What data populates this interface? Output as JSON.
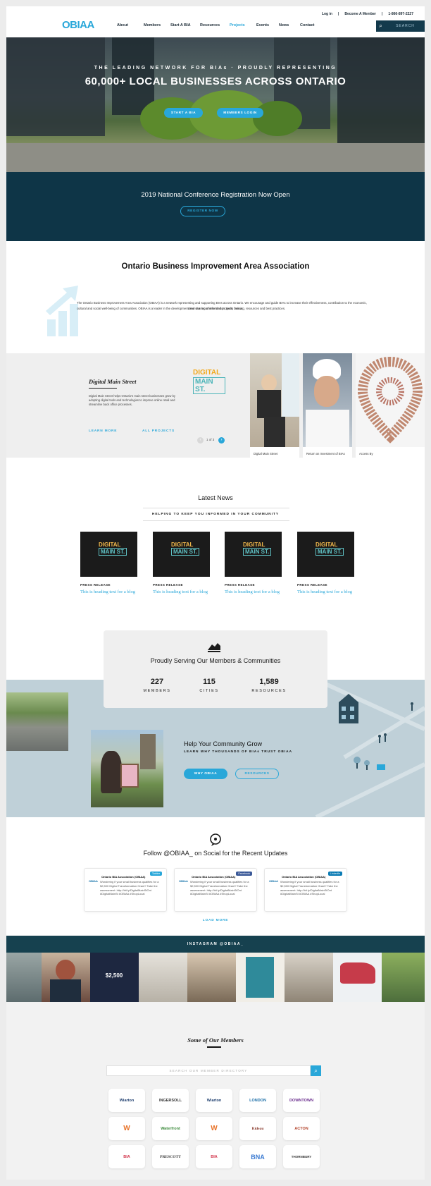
{
  "header": {
    "util_links": [
      "Log in",
      "|",
      "Become A Member",
      "|",
      "1-866-897-2227"
    ],
    "logo_text": "OBIAA",
    "nav": [
      "About",
      "Members",
      "Start A BIA",
      "Resources",
      "Projects",
      "Events",
      "News",
      "Contact"
    ],
    "active_nav": "Projects",
    "search_placeholder": "SEARCH"
  },
  "hero": {
    "eyebrow": "THE LEADING NETWORK FOR BIAs · PROUDLY REPRESENTING",
    "headline": "60,000+ LOCAL BUSINESSES ACROSS ONTARIO",
    "btn_primary": "START A BIA",
    "btn_secondary": "MEMBERS LOGIN"
  },
  "conference": {
    "title": "2019 National Conference Registration Now Open",
    "button": "REGISTER NOW"
  },
  "about": {
    "title": "Ontario Business Improvement Area Association",
    "body": "The Ontario Business Improvement Area Association (OBIAA) is a network representing and supporting BIAs across Ontario. We encourage and guide BIAs to increase their effectiveness, contribution to the economic, cultural and social well-being of communities. OBIAA is a leader in the development and sharing of information, tools, training, resources and best practices.",
    "projects_intro": "View our recommended projects below:"
  },
  "projects": {
    "title": "Digital Main Street",
    "description": "Digital Main Street helps Ontario's main street businesses grow by adopting digital tools and technologies to improve online retail and streamline back office processes.",
    "learn_more": "LEARN MORE",
    "all_projects": "ALL PROJECTS",
    "pager": "1 of 3",
    "logo_line1": "DIGITAL",
    "logo_line2": "MAIN ST.",
    "tiles": [
      "Digital Main Street",
      "Return on Investment of BIAs",
      "Access By"
    ]
  },
  "news": {
    "title": "Latest News",
    "subtitle": "HELPING TO KEEP YOU INFORMED IN YOUR COMMUNITY",
    "cards": [
      {
        "label": "PRESS RELEASE",
        "title": "This is heading text for a blog"
      },
      {
        "label": "PRESS RELEASE",
        "title": "This is heading text for a blog"
      },
      {
        "label": "PRESS RELEASE",
        "title": "This is heading text for a blog"
      },
      {
        "label": "PRESS RELEASE",
        "title": "This is heading text for a blog"
      }
    ],
    "sign_line1": "DIGITAL",
    "sign_line2": "MAIN ST."
  },
  "stats": {
    "title": "Proudly Serving Our Members & Communities",
    "items": [
      {
        "value": "227",
        "label": "MEMBERS"
      },
      {
        "value": "115",
        "label": "CITIES"
      },
      {
        "value": "1,589",
        "label": "RESOURCES"
      }
    ]
  },
  "grow": {
    "title": "Help Your Community Grow",
    "subtitle": "LEARN WHY THOUSANDS OF BIAs TRUST OBIAA",
    "btn_primary": "WHY OBIAA",
    "btn_secondary": "RESOURCES"
  },
  "social": {
    "title": "Follow @OBIAA_ on Social for the Recent Updates",
    "cards": [
      {
        "account": "Ontario BIA Association (OBIAA)",
        "network": "Twitter",
        "body": "Wondering if your small business qualifies for a $2,500 Digital Transformation Grant? Take the assessment: http://bit.ly/DigitalMainStOnt #DigitalMainSt #OBIAA #ShopLocal"
      },
      {
        "account": "Ontario BIA Association (OBIAA)",
        "network": "Facebook",
        "body": "Wondering if your small business qualifies for a $2,500 Digital Transformation Grant? Take the assessment: http://bit.ly/DigitalMainStOnt #DigitalMainSt #OBIAA #ShopLocal"
      },
      {
        "account": "Ontario BIA Association (OBIAA)",
        "network": "LinkedIn",
        "body": "Wondering if your small business qualifies for a $2,500 Digital Transformation Grant? Take the assessment: http://bit.ly/DigitalMainStOnt #DigitalMainSt #OBIAA #ShopLocal"
      }
    ],
    "load_more": "LOAD MORE"
  },
  "instagram": {
    "bar": "INSTAGRAM @OBIAA_",
    "tile_text": "$2,500"
  },
  "members": {
    "title": "Some of Our Members",
    "search_placeholder": "SEARCH OUR MEMBER DIRECTORY",
    "logos": [
      "Wiarton",
      "INGERSOLL",
      "Wiarton",
      "LONDON",
      "DOWNTOWN",
      "W",
      "Waterfront",
      "W",
      "Rideau",
      "ACTON",
      "BIA",
      "PRESCOTT",
      "BIA",
      "BNA",
      "THORNBURY"
    ]
  }
}
